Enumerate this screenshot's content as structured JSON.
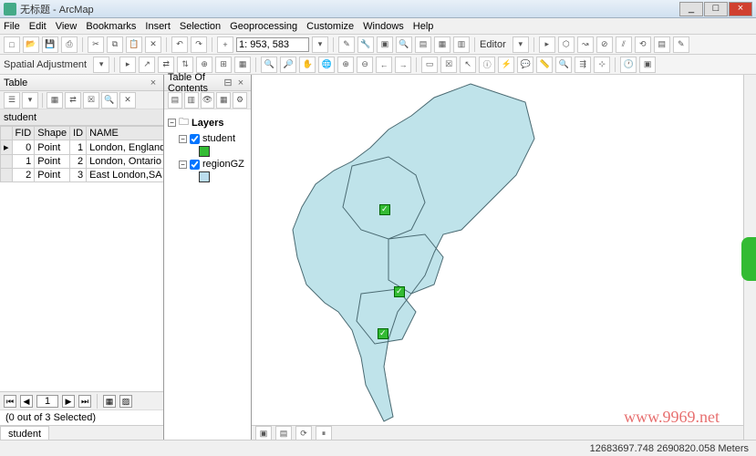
{
  "window": {
    "title": "无标题 - ArcMap"
  },
  "menu": [
    "File",
    "Edit",
    "View",
    "Bookmarks",
    "Insert",
    "Selection",
    "Geoprocessing",
    "Customize",
    "Windows",
    "Help"
  ],
  "toolbar1": {
    "scale": "1: 953, 583"
  },
  "toolbar2": {
    "label": "Spatial Adjustment",
    "editor_label": "Editor"
  },
  "table_panel": {
    "title": "Table",
    "layer_name": "student",
    "columns": [
      "FID",
      "Shape",
      "ID",
      "NAME"
    ],
    "rows": [
      {
        "fid": "0",
        "shape": "Point",
        "id": "1",
        "name": "London, England"
      },
      {
        "fid": "1",
        "shape": "Point",
        "id": "2",
        "name": "London, Ontario"
      },
      {
        "fid": "2",
        "shape": "Point",
        "id": "3",
        "name": "East London,SA"
      }
    ],
    "nav_current": "1",
    "selection_text": "(0 out of 3 Selected)",
    "tab_label": "student"
  },
  "toc": {
    "title": "Table Of Contents",
    "root": "Layers",
    "layers": [
      {
        "name": "student",
        "checked": true
      },
      {
        "name": "regionGZ",
        "checked": true
      }
    ]
  },
  "status": {
    "coords": "12683697.748 2690820.058 Meters"
  },
  "watermark": "www.9969.net"
}
